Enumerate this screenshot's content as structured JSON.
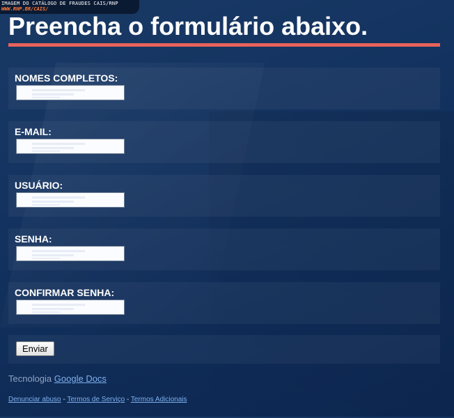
{
  "watermark": {
    "line1": "IMAGEM DO CATÁLOGO DE FRAUDES CAIS/RNP",
    "line2": "WWW.RNP.BR/CAIS/"
  },
  "form": {
    "title": "Preencha o formulário abaixo.",
    "fields": [
      {
        "label": "NOMES COMPLETOS:",
        "value": "",
        "type": "text"
      },
      {
        "label": "E-MAIL:",
        "value": "",
        "type": "text"
      },
      {
        "label": "USUÁRIO:",
        "value": "",
        "type": "text"
      },
      {
        "label": "SENHA:",
        "value": "",
        "type": "password"
      },
      {
        "label": "CONFIRMAR SENHA:",
        "value": "",
        "type": "password"
      }
    ],
    "submit_label": "Enviar"
  },
  "powered": {
    "prefix": "Tecnologia",
    "link": "Google Docs"
  },
  "footer": {
    "report_abuse": "Denunciar abuso",
    "separator": "-",
    "terms": "Termos de Serviço",
    "additional_terms": "Termos Adicionais"
  },
  "colors": {
    "background": "#143360",
    "title_rule": "#e8635a",
    "link": "#7fb0ee",
    "watermark_accent": "#ff7a3a"
  }
}
